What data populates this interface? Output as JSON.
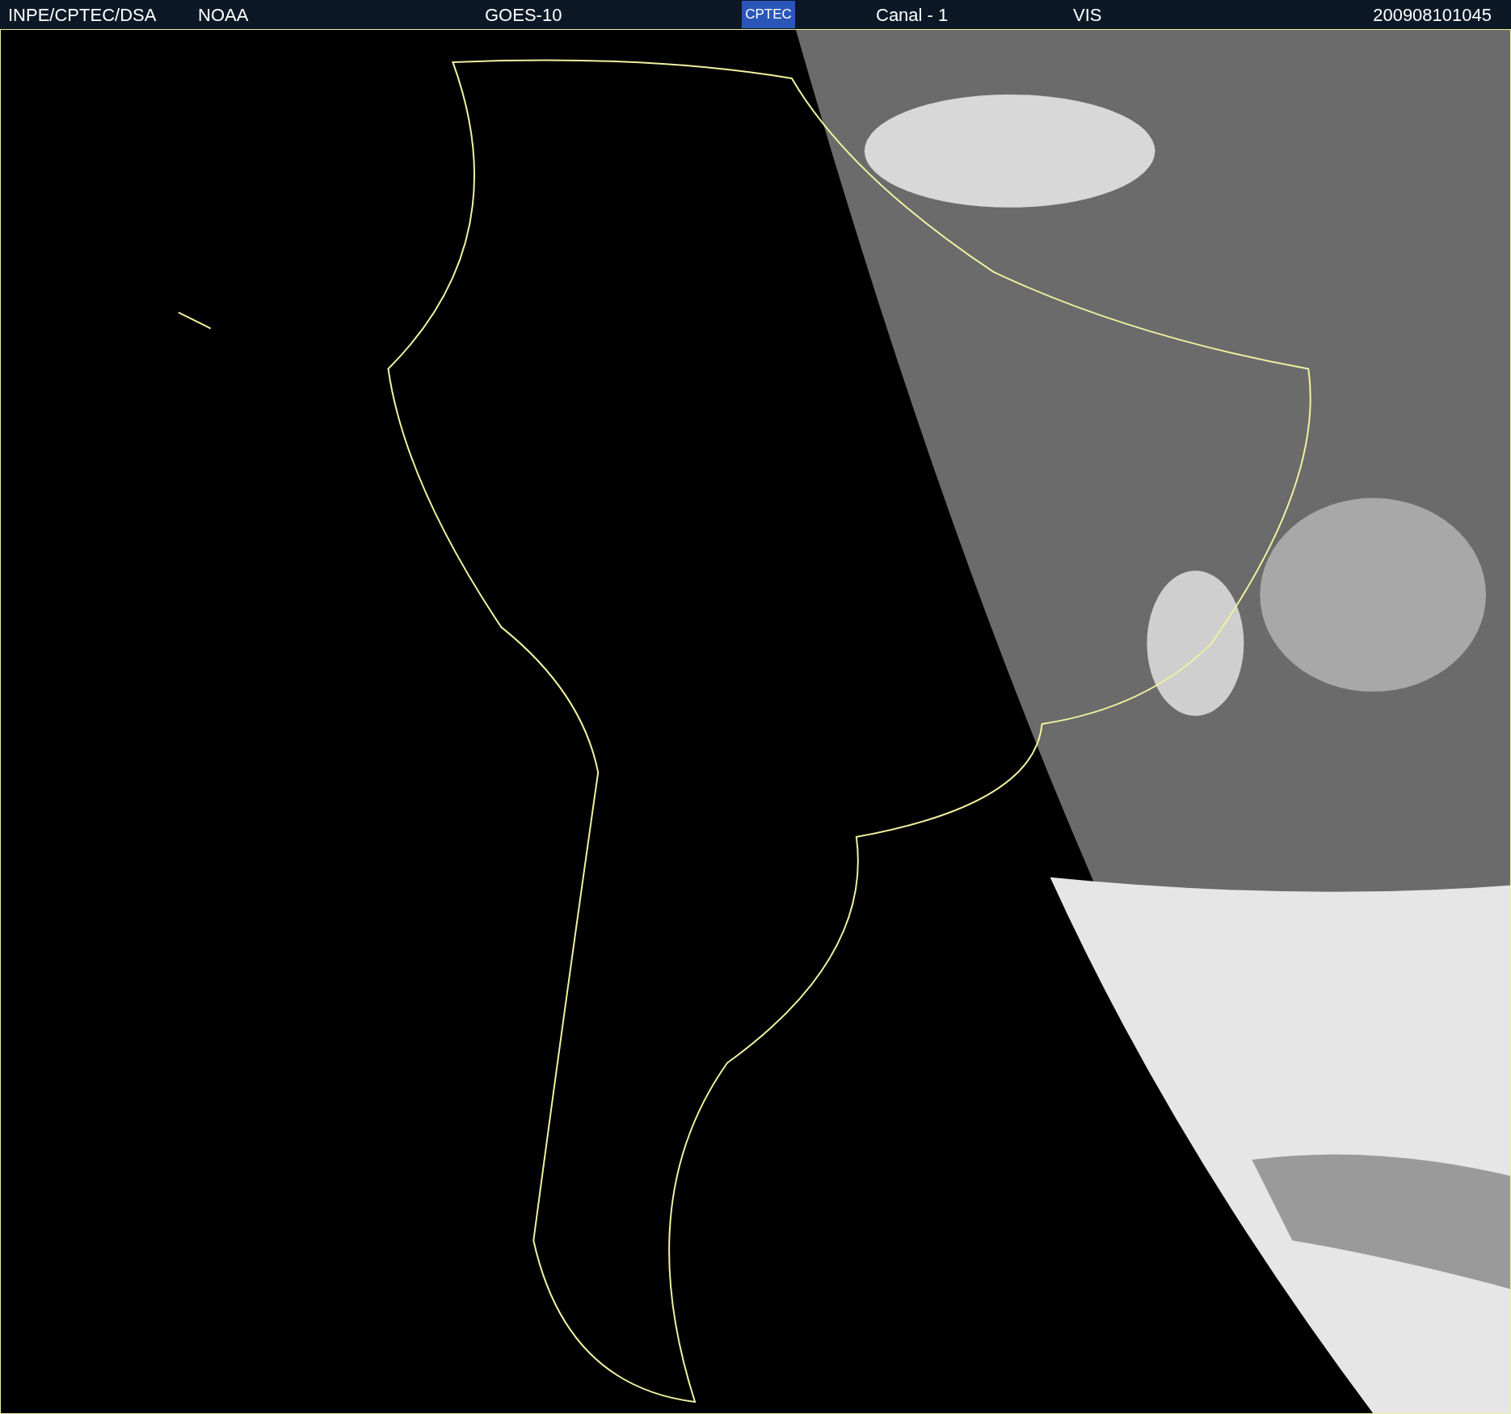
{
  "header": {
    "institution": "INPE/CPTEC/DSA",
    "agency": "NOAA",
    "satellite": "GOES-10",
    "logo": "CPTEC",
    "channel": "Canal - 1",
    "band": "VIS",
    "timestamp": "200908101045"
  }
}
